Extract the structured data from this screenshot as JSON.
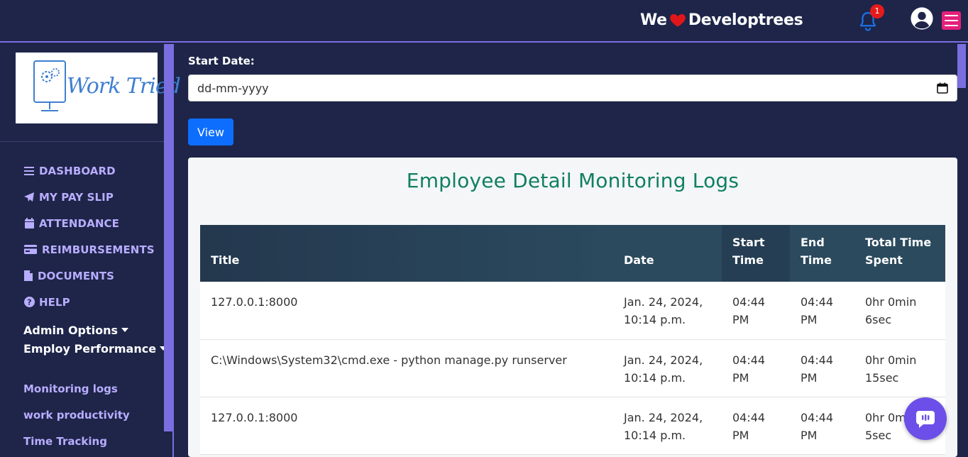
{
  "header": {
    "brand_we": "We",
    "brand_name": "Developtrees",
    "notification_count": "1"
  },
  "sidebar": {
    "logo_text": "Work Tried",
    "nav": [
      {
        "label": "DASHBOARD",
        "icon": "bars-icon"
      },
      {
        "label": "MY PAY SLIP",
        "icon": "paper-plane-icon"
      },
      {
        "label": "ATTENDANCE",
        "icon": "calendar-icon"
      },
      {
        "label": "REIMBURSEMENTS",
        "icon": "credit-card-icon"
      },
      {
        "label": "DOCUMENTS",
        "icon": "file-icon"
      },
      {
        "label": "HELP",
        "icon": "question-circle-icon"
      }
    ],
    "admin_options": "Admin Options",
    "employ_performance": "Employ Performance",
    "sublinks": [
      "Monitoring logs",
      "work productivity",
      "Time Tracking"
    ]
  },
  "filter": {
    "start_label": "Start Date:",
    "date_placeholder": "dd-mm-yyyy",
    "view_label": "View"
  },
  "logs": {
    "title": "Employee Detail Monitoring Logs",
    "columns": [
      "Title",
      "Date",
      "Start Time",
      "End Time",
      "Total Time Spent"
    ],
    "rows": [
      [
        "127.0.0.1:8000",
        "Jan. 24, 2024, 10:14 p.m.",
        "04:44 PM",
        "04:44 PM",
        "0hr 0min 6sec"
      ],
      [
        "C:\\Windows\\System32\\cmd.exe - python manage.py runserver",
        "Jan. 24, 2024, 10:14 p.m.",
        "04:44 PM",
        "04:44 PM",
        "0hr 0min 15sec"
      ],
      [
        "127.0.0.1:8000",
        "Jan. 24, 2024, 10:14 p.m.",
        "04:44 PM",
        "04:44 PM",
        "0hr 0min 5sec"
      ]
    ]
  },
  "colors": {
    "background": "#1e2549",
    "accent": "#7b6ee0",
    "nav_text": "#b9adff",
    "title_green": "#108060",
    "button_blue": "#0d6efd",
    "menu_pink": "#e4207b"
  }
}
